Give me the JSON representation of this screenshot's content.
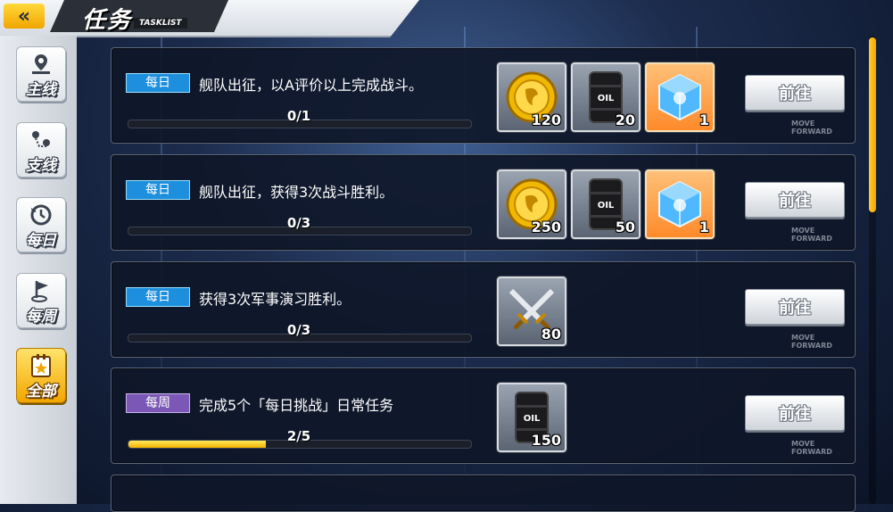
{
  "header": {
    "back_icon": "double-chevron-left-icon",
    "title": "任务",
    "subtitle": "TASKLIST"
  },
  "sidebar": {
    "items": [
      {
        "label": "主线",
        "icon": "map-pin-icon",
        "active": false
      },
      {
        "label": "支线",
        "icon": "route-pins-icon",
        "active": false
      },
      {
        "label": "每日",
        "icon": "clock-history-icon",
        "active": false
      },
      {
        "label": "每周",
        "icon": "flag-icon",
        "active": false
      },
      {
        "label": "全部",
        "icon": "star-document-icon",
        "active": true
      }
    ]
  },
  "tasks": [
    {
      "tag": "每日",
      "tag_type": "daily",
      "description": "舰队出征，以A评价以上完成战斗。",
      "progress_text": "0/1",
      "progress": 0,
      "rewards": [
        {
          "icon": "gold-coin-icon",
          "qty": "120"
        },
        {
          "icon": "oil-barrel-icon",
          "qty": "20"
        },
        {
          "icon": "blue-cube-icon",
          "qty": "1"
        }
      ],
      "button": "前往",
      "button_sub": "MOVE FORWARD"
    },
    {
      "tag": "每日",
      "tag_type": "daily",
      "description": "舰队出征，获得3次战斗胜利。",
      "progress_text": "0/3",
      "progress": 0,
      "rewards": [
        {
          "icon": "gold-coin-icon",
          "qty": "250"
        },
        {
          "icon": "oil-barrel-icon",
          "qty": "50"
        },
        {
          "icon": "blue-cube-icon",
          "qty": "1"
        }
      ],
      "button": "前往",
      "button_sub": "MOVE FORWARD"
    },
    {
      "tag": "每日",
      "tag_type": "daily",
      "description": "获得3次军事演习胜利。",
      "progress_text": "0/3",
      "progress": 0,
      "rewards": [
        {
          "icon": "crossed-swords-icon",
          "qty": "80"
        }
      ],
      "button": "前往",
      "button_sub": "MOVE FORWARD"
    },
    {
      "tag": "每周",
      "tag_type": "weekly",
      "description": "完成5个「每日挑战」日常任务",
      "progress_text": "2/5",
      "progress": 0.4,
      "rewards": [
        {
          "icon": "oil-barrel-icon",
          "qty": "150"
        }
      ],
      "button": "前往",
      "button_sub": "MOVE FORWARD"
    }
  ],
  "colors": {
    "accent_yellow": "#f3a300",
    "daily_tag": "#1d8fdd",
    "weekly_tag": "#7b58b5"
  }
}
